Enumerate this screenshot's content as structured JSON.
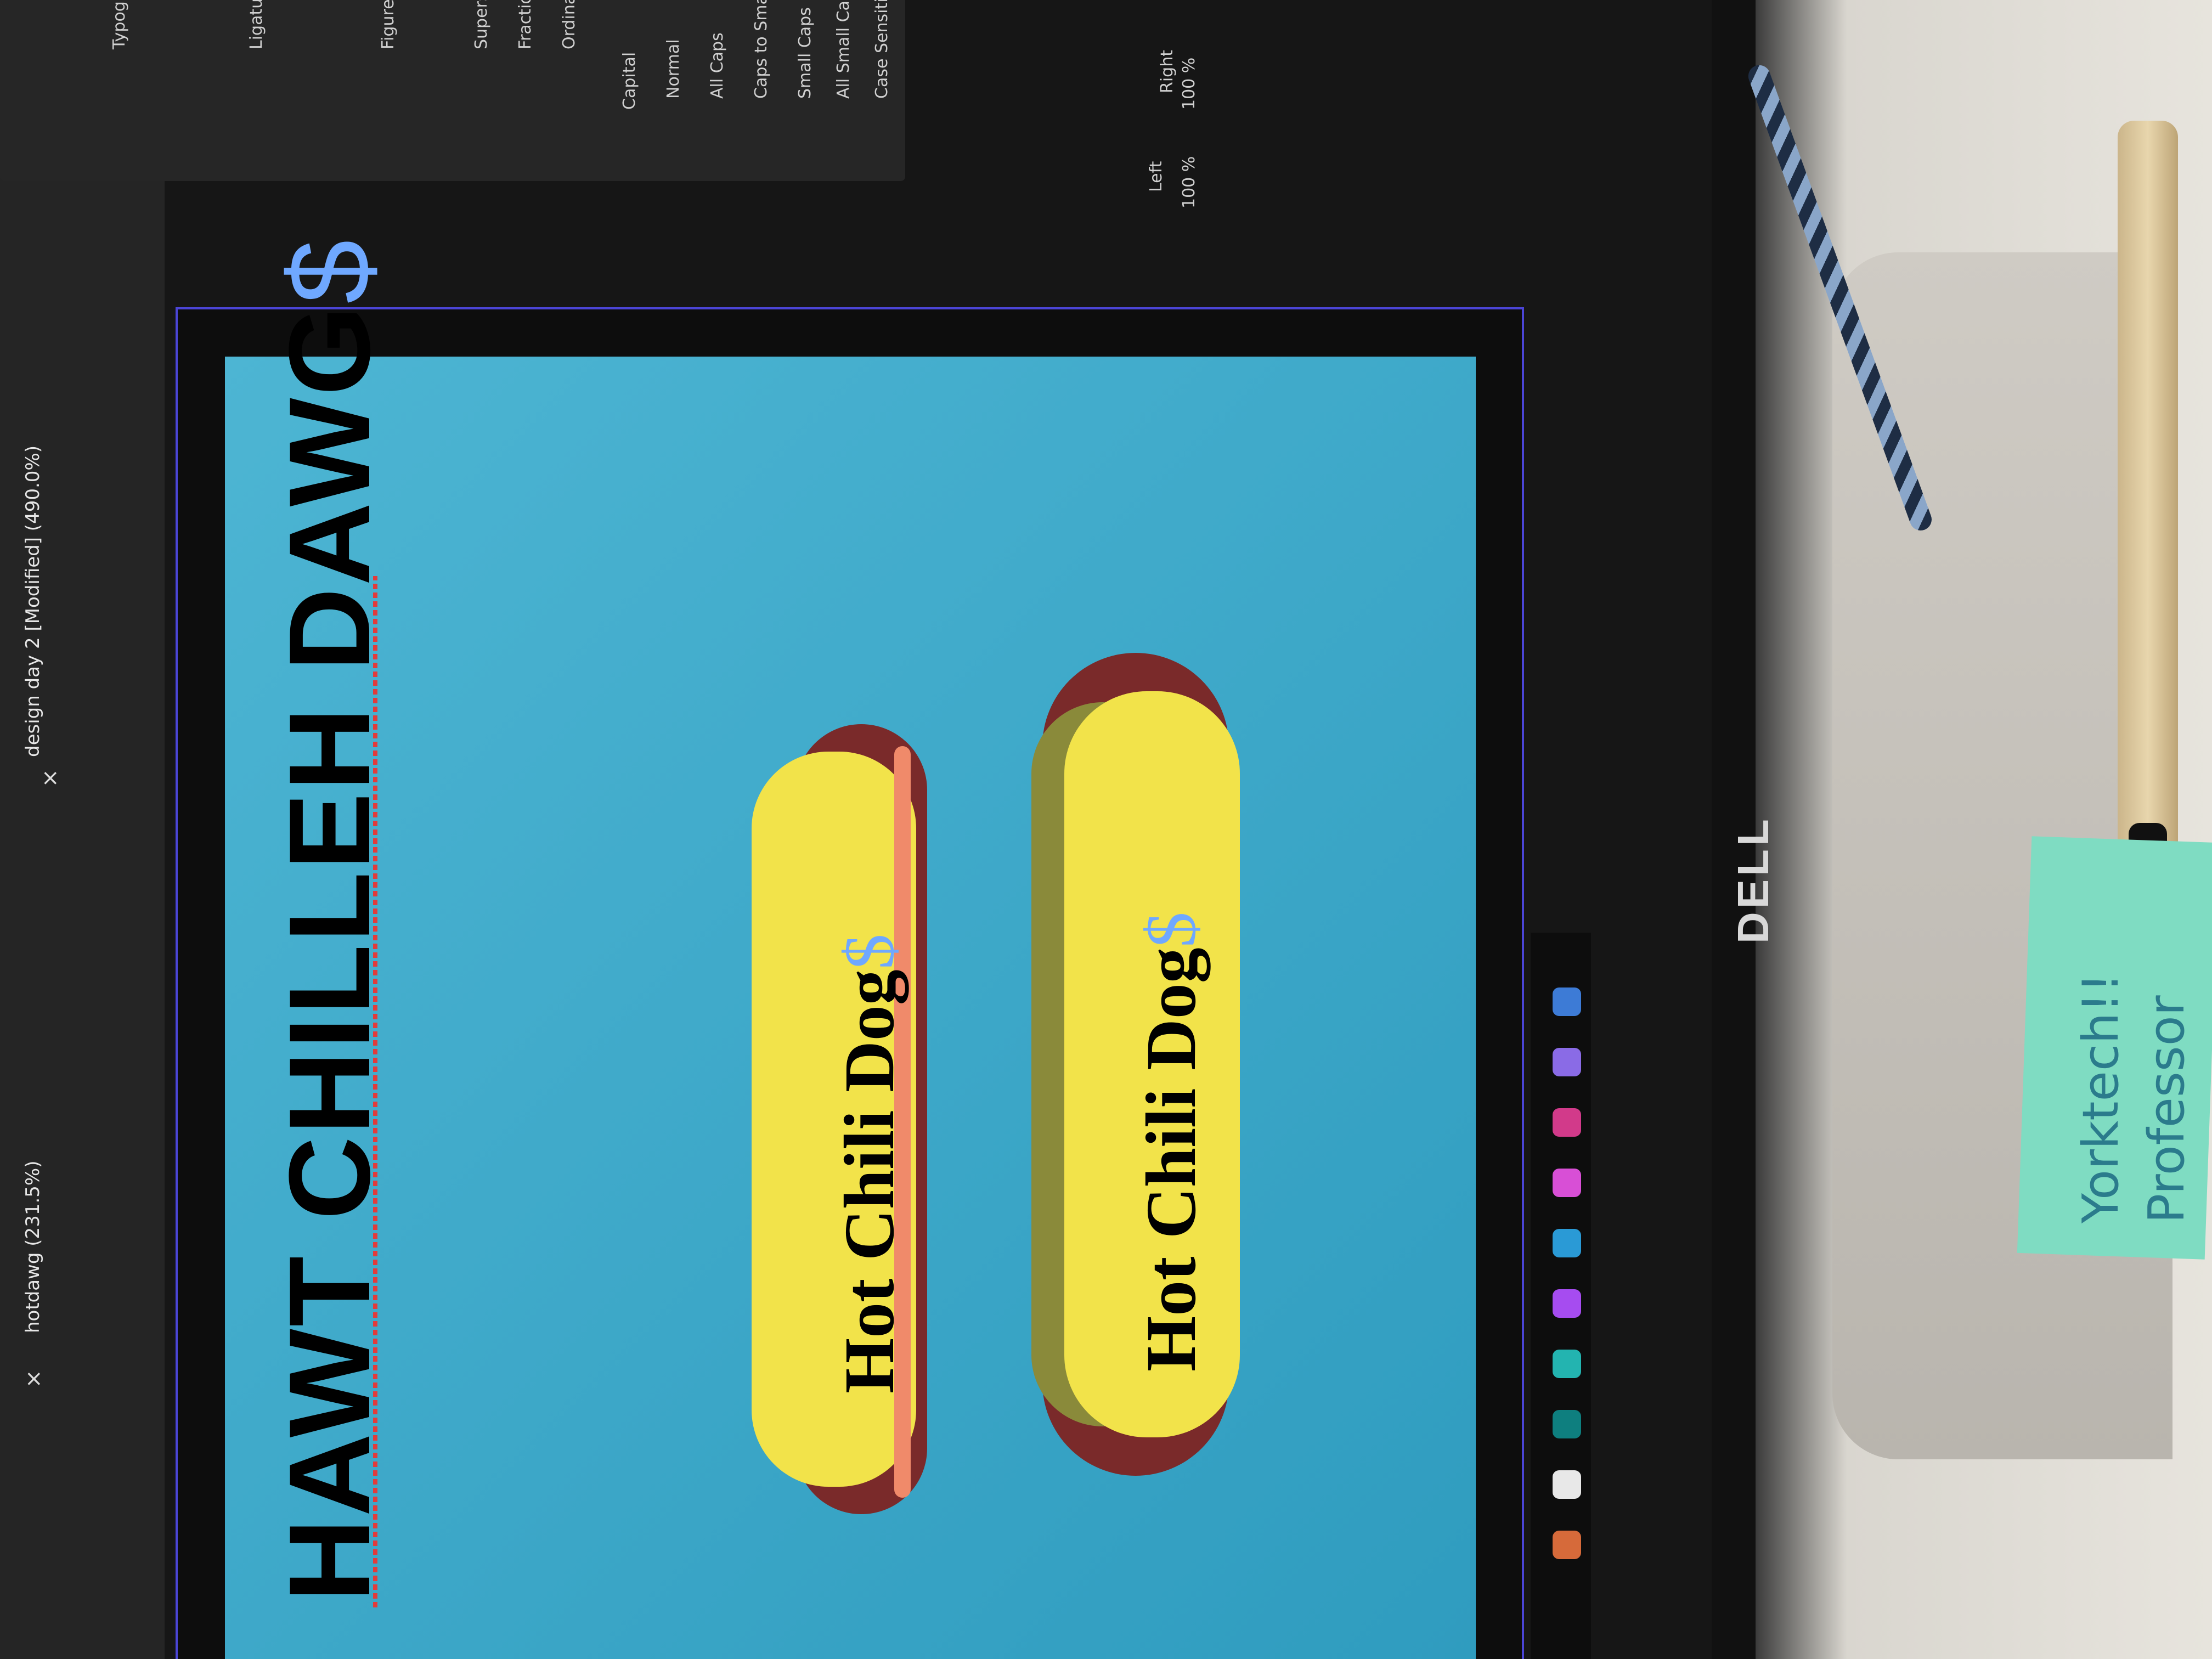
{
  "app": {
    "tabs": [
      {
        "label": "hotdawg (231.5%)"
      },
      {
        "label": "design day 2 [Modified] (490.0%)"
      }
    ]
  },
  "panel": {
    "capital_heading": "Capital",
    "capital_options": [
      "Normal",
      "All Caps",
      "Caps to Small",
      "Small Caps",
      "All Small Caps",
      "Case Sensitive"
    ],
    "other_labels": [
      "Typog",
      "Ligatu",
      "Figure Pu",
      "Fraction",
      "Ordinal",
      "Superscr"
    ],
    "left_label": "Left",
    "right_label": "Right",
    "left_value": "100 %",
    "right_value": "100 %"
  },
  "artwork": {
    "headline_main": "HAWT CHILLEH DAWG",
    "headline_symbol": "$",
    "hotdog_label_1": "Hot Chili Dog",
    "hotdog_label_2": "Hot Chili Dog",
    "hotdog_symbol": "$"
  },
  "desk": {
    "monitor_brand": "DELL",
    "sticky_note_line1": "Yorktech!!",
    "sticky_note_line2": "Professor"
  },
  "colors": {
    "artboard": "#3aa6c8",
    "bun": "#f2e34a",
    "sausage": "#7a2a2a",
    "chili": "#8a8a3a",
    "accent_outline": "#4b45d6"
  }
}
